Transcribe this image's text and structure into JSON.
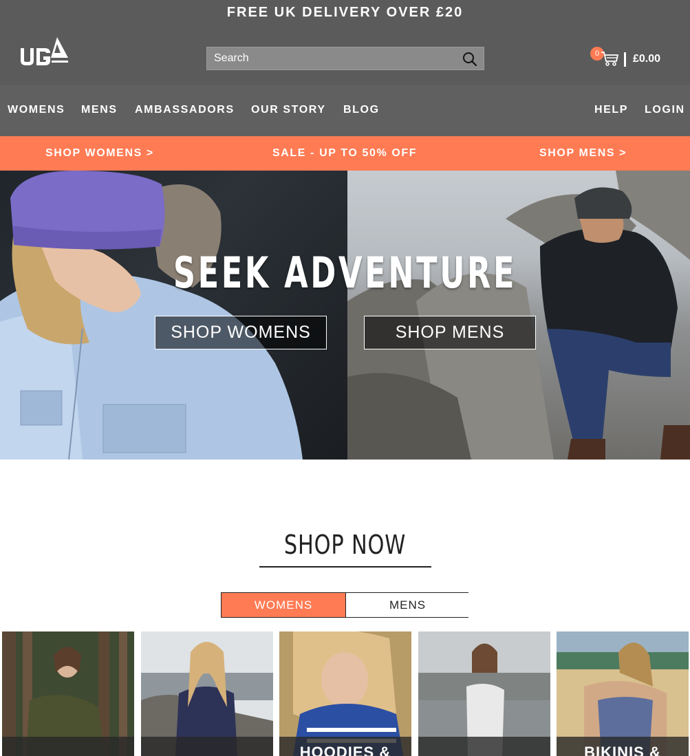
{
  "header": {
    "promo": "FREE UK DELIVERY OVER £20",
    "search_placeholder": "Search",
    "cart_count": "0",
    "cart_total": "£0.00"
  },
  "nav": {
    "items": [
      "WOMENS",
      "MENS",
      "AMBASSADORS",
      "OUR STORY",
      "BLOG"
    ],
    "help": "HELP",
    "login": "LOGIN"
  },
  "salebar": {
    "shop_womens": "SHOP WOMENS >",
    "sale": "SALE - UP TO 50% OFF",
    "shop_mens": "SHOP MENS >"
  },
  "hero": {
    "title": "SEEK ADVENTURE",
    "btn_womens": "SHOP WOMENS",
    "btn_mens": "SHOP MENS"
  },
  "shop_now": {
    "title": "SHOP NOW",
    "tabs": [
      "WOMENS",
      "MENS"
    ],
    "active_tab": "WOMENS"
  },
  "cards": [
    {
      "label": ""
    },
    {
      "label": ""
    },
    {
      "label": "HOODIES &"
    },
    {
      "label": ""
    },
    {
      "label": "BIKINIS &"
    }
  ],
  "colors": {
    "accent": "#ff7b54",
    "header_bg": "#5b5b5b",
    "nav_bg": "#606060"
  },
  "icons": [
    "ub-logo",
    "search-icon",
    "cart-icon"
  ]
}
